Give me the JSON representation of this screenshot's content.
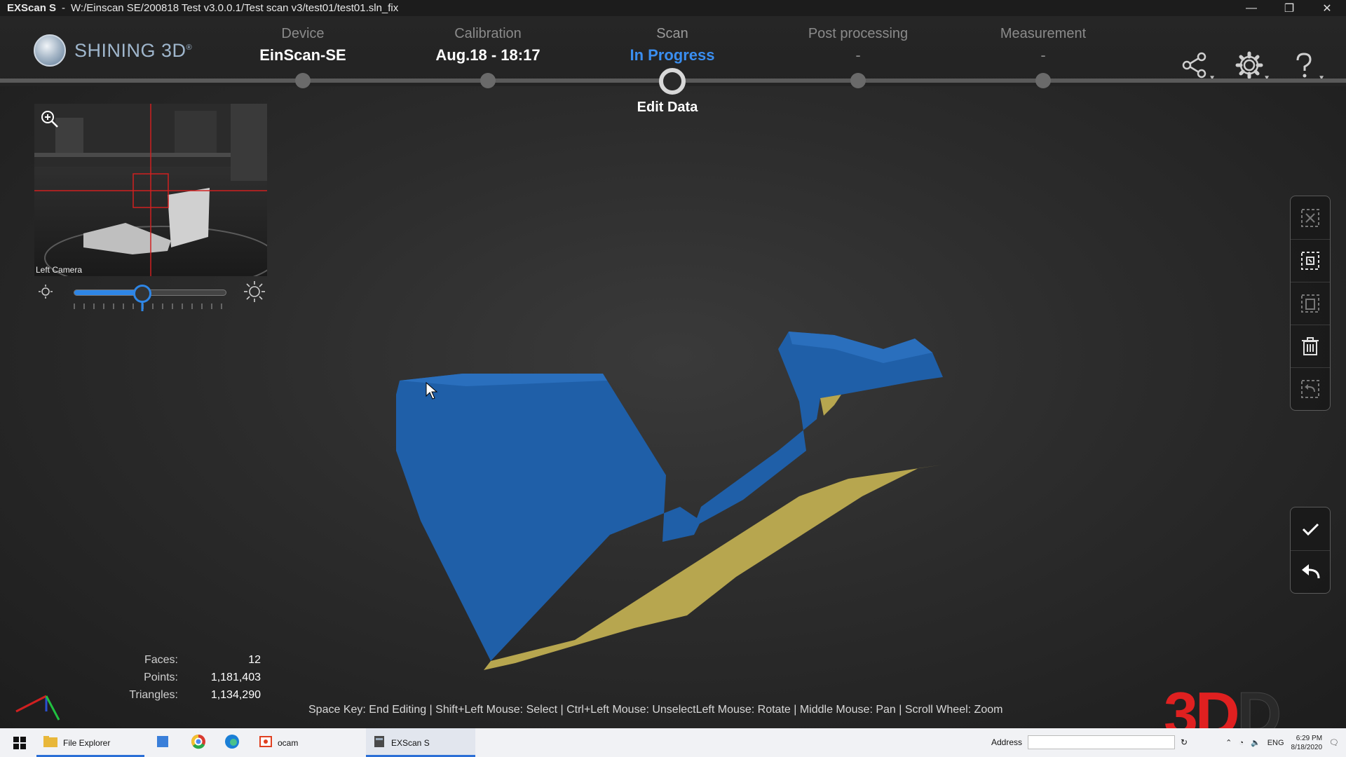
{
  "titlebar": {
    "app_name": "EXScan S",
    "separator": "-",
    "path": "W:/Einscan SE/200818 Test v3.0.0.1/Test scan v3/test01/test01.sln_fix",
    "minimize": "—",
    "restore": "❐",
    "close": "✕"
  },
  "header": {
    "logo_text": "SHINING 3D",
    "logo_reg": "®",
    "steps": [
      {
        "label": "Device",
        "value": "EinScan-SE"
      },
      {
        "label": "Calibration",
        "value": "Aug.18 - 18:17"
      },
      {
        "label": "Scan",
        "value": "In Progress"
      },
      {
        "label": "Post processing",
        "value": "-"
      },
      {
        "label": "Measurement",
        "value": "-"
      }
    ],
    "sub_step": "Edit Data",
    "icons": [
      "share-icon",
      "settings-icon",
      "help-icon"
    ]
  },
  "camera": {
    "label": "Left Camera",
    "brightness_level": 0.45
  },
  "right_toolbar": {
    "tools": [
      "deselect-icon",
      "select-region-icon",
      "select-connected-icon",
      "delete-icon",
      "undo-selection-icon"
    ],
    "actions": [
      "apply-check-icon",
      "back-arrow-icon"
    ]
  },
  "stats": [
    {
      "key": "Faces:",
      "value": "12"
    },
    {
      "key": "Points:",
      "value": "1,181,403"
    },
    {
      "key": "Triangles:",
      "value": "1,134,290"
    }
  ],
  "hint": "Space Key: End Editing | Shift+Left Mouse: Select | Ctrl+Left Mouse: UnselectLeft Mouse: Rotate | Middle Mouse: Pan | Scroll Wheel: Zoom",
  "watermark": {
    "red": "3D",
    "dark": "D"
  },
  "taskbar": {
    "apps": [
      {
        "label": "File Explorer"
      },
      {
        "label": ""
      },
      {
        "label": ""
      },
      {
        "label": ""
      },
      {
        "label": "ocam"
      },
      {
        "label": "EXScan S"
      }
    ],
    "address_label": "Address",
    "lang": "ENG",
    "time": "6:29 PM",
    "date": "8/18/2020"
  },
  "colors": {
    "accent": "#3a8ef0",
    "model_top": "#1f5fa8",
    "model_bottom": "#b7a64f",
    "watermark_red": "#e02020"
  }
}
